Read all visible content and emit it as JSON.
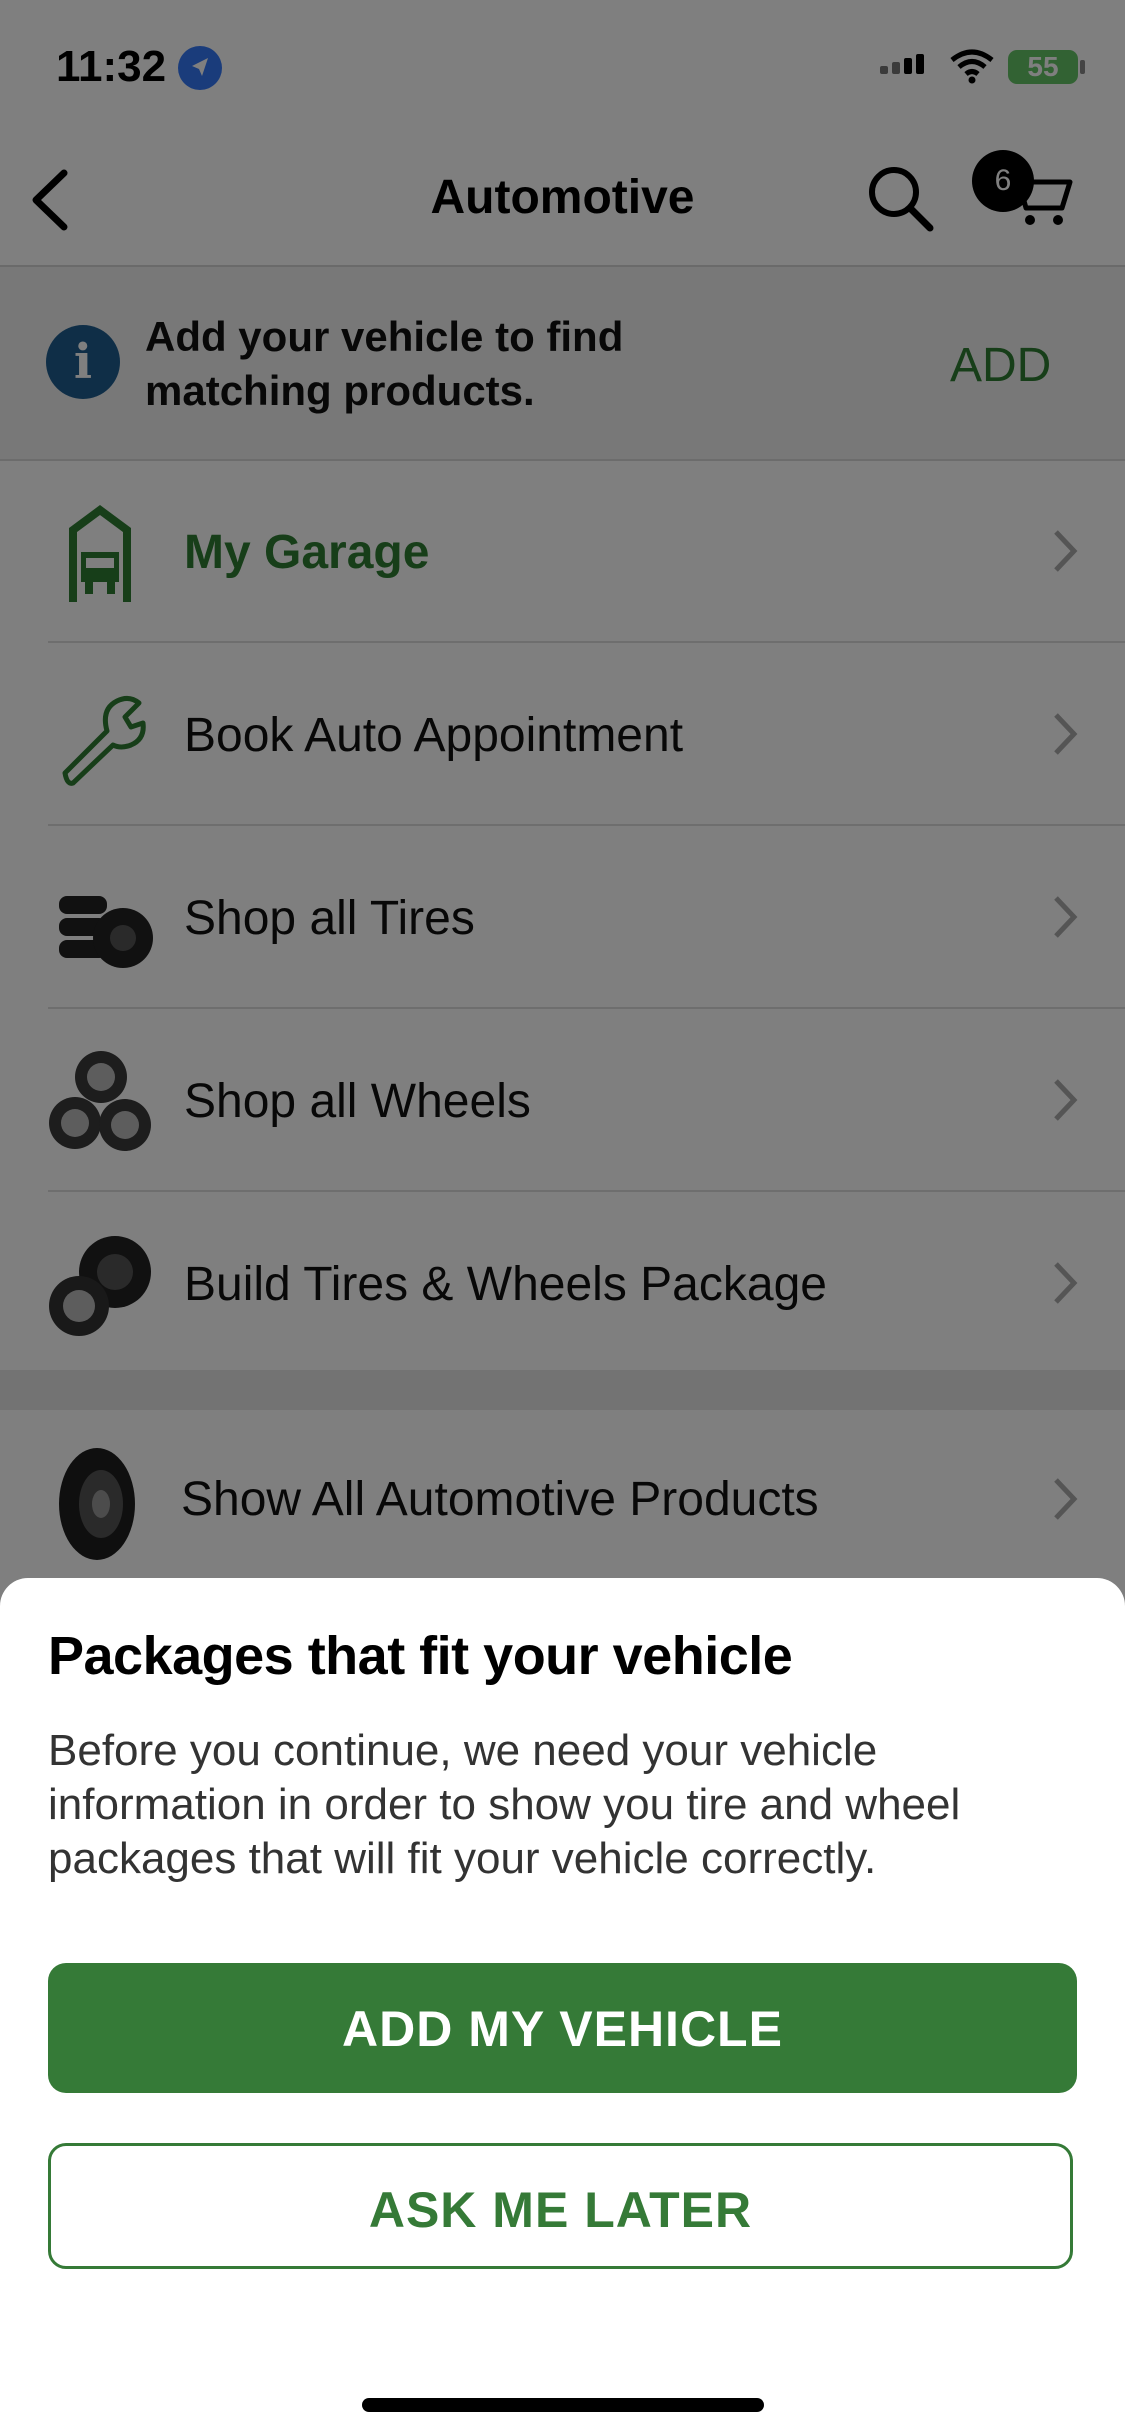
{
  "status_bar": {
    "time": "11:32",
    "battery": "55"
  },
  "nav": {
    "title": "Automotive",
    "cart_count": "6"
  },
  "banner": {
    "text": "Add your vehicle to find matching products.",
    "action": "ADD"
  },
  "menu": {
    "items": [
      {
        "label": "My Garage",
        "icon": "garage-icon"
      },
      {
        "label": "Book Auto Appointment",
        "icon": "wrench-icon"
      },
      {
        "label": "Shop all Tires",
        "icon": "tires-icon"
      },
      {
        "label": "Shop all Wheels",
        "icon": "wheels-icon"
      },
      {
        "label": "Build Tires & Wheels Package",
        "icon": "tire-wheel-package-icon"
      }
    ],
    "all_products": {
      "label": "Show All Automotive Products",
      "icon": "tire-icon"
    }
  },
  "sheet": {
    "title": "Packages that fit your vehicle",
    "body": "Before you continue, we need your vehicle information in order to show you tire and wheel packages that will fit your vehicle correctly.",
    "primary_button": "ADD MY VEHICLE",
    "secondary_button": "ASK ME LATER"
  },
  "colors": {
    "accent": "#357a37",
    "info": "#1e5d8f",
    "overlay": "rgba(0,0,0,0.5)"
  }
}
